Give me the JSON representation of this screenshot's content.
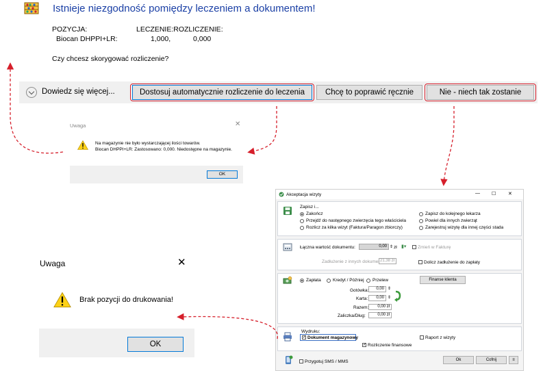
{
  "top_dialog": {
    "title": "Istnieje niezgodność pomiędzy leczeniem a dokumentem!",
    "header_position": "POZYCJA:",
    "header_treatment_settlement": "LECZENIE:ROZLICZENIE:",
    "item_name": "Biocan DHPPI+LR:",
    "item_treatment": "1,000,",
    "item_settlement": "0,000",
    "question": "Czy chcesz skorygować rozliczenie?",
    "more_label": "Dowiedz się więcej...",
    "btn_auto": "Dostosuj automatycznie rozliczenie do leczenia",
    "btn_manual": "Chcę to poprawić ręcznie",
    "btn_no": "Nie - niech tak zostanie"
  },
  "small_warning": {
    "title": "Uwaga",
    "line1": "Na magazynie nie było wystarczającej ilości towarów.",
    "line2": "Biocan DHPPI+LR: Zastosowano: 0,000. Niedostępne na magazynie.",
    "ok": "OK"
  },
  "big_warning": {
    "title": "Uwaga",
    "message": "Brak pozycji do drukowania!",
    "ok": "OK"
  },
  "akceptacja": {
    "title": "Akceptacja wizyty",
    "zapisz_label": "Zapisz i...",
    "options_left": [
      "Zakończ",
      "Przejdź do następnego zwierzęcia tego właściciela",
      "Rozlicz za kilka wizyt (Faktura/Paragon zbiorczy)"
    ],
    "options_right": [
      "Zapisz do kolejnego lekarza",
      "Powiel dla innych zwierząt",
      "Zarejestruj wizytę dla innej części stada"
    ],
    "total_label": "Łączna wartość dokumentu:",
    "total_value": "0,00",
    "currency": "zł",
    "invoice_change": "Zmień w Fakturę",
    "debt_label": "Zadłużenie z innych dokumentów",
    "debt_value": "21,38 zł",
    "add_debt": "Dolicz zadłużenie do zapłaty",
    "pay_options": [
      "Zapłata",
      "Kredyt / Później",
      "Przelew"
    ],
    "finance_btn": "Finanse klienta",
    "cash_label": "Gotówka:",
    "cash_value": "0,00",
    "card_label": "Karta:",
    "card_value": "0,00",
    "total2_label": "Razem:",
    "total2_value": "0,00 zł",
    "advance_label": "Zaliczka/Dług:",
    "advance_value": "0,00 zł",
    "print_label": "Wydruku:",
    "print_doc": "Dokument magazynowy",
    "print_report": "Raport z wizyty",
    "print_finance": "Rozliczenie finansowe",
    "sms_label": "Przygotuj SMS / MMS",
    "ok": "Ok",
    "cancel": "Cofnij",
    "win_minimize": "—",
    "win_maximize": "☐",
    "win_close": "✕"
  },
  "colors": {
    "title_blue": "#1a3fa5",
    "highlight_red": "#d61f2b",
    "button_bg": "#e1e1e1",
    "bar_bg": "#f0f0f0"
  }
}
